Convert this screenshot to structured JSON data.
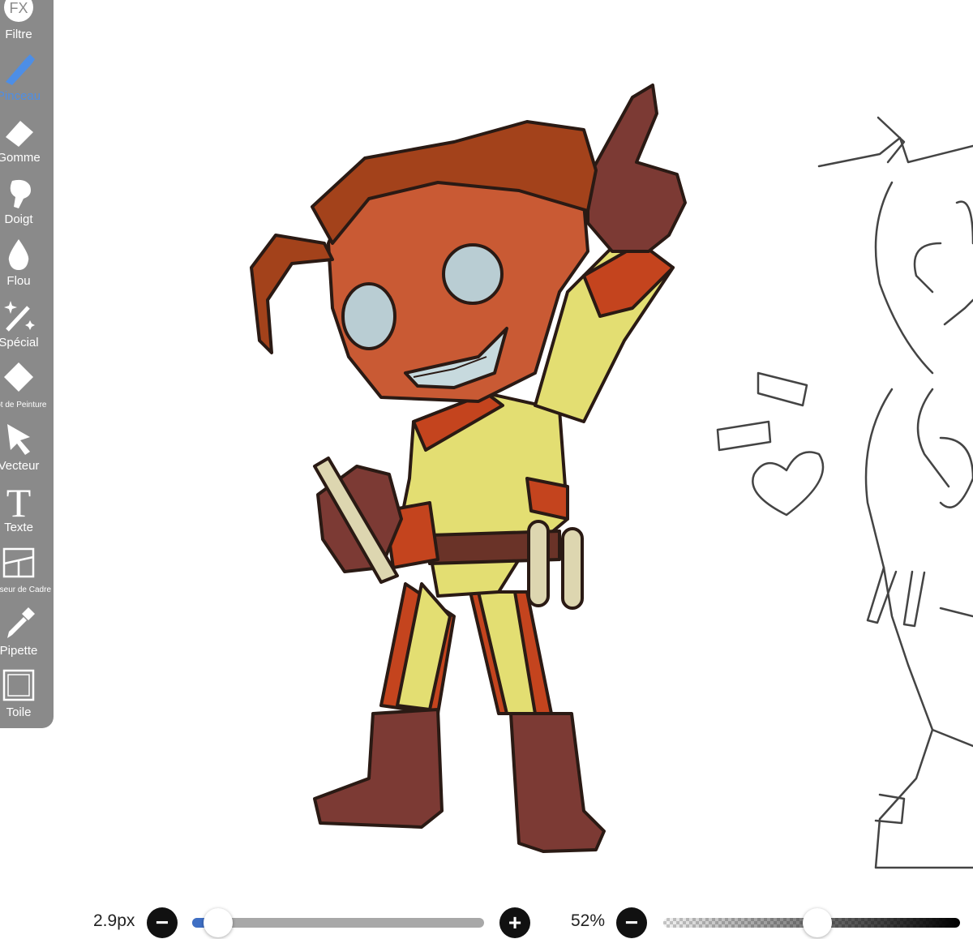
{
  "toolbar": {
    "tools": [
      {
        "name": "tool-filtre",
        "icon": "fx-icon",
        "label": "Filtre"
      },
      {
        "name": "tool-pinceau",
        "icon": "brush-icon",
        "label": "Pinceau",
        "active": true
      },
      {
        "name": "tool-gomme",
        "icon": "eraser-icon",
        "label": "Gomme"
      },
      {
        "name": "tool-doigt",
        "icon": "smudge-icon",
        "label": "Doigt"
      },
      {
        "name": "tool-flou",
        "icon": "blur-drop-icon",
        "label": "Flou"
      },
      {
        "name": "tool-special",
        "icon": "sparkle-wand-icon",
        "label": "Spécial"
      },
      {
        "name": "tool-pot-de-peinture",
        "icon": "paint-bucket-icon",
        "label": "Pot de Peinture"
      },
      {
        "name": "tool-vecteur",
        "icon": "arrow-pointer-icon",
        "label": "Vecteur"
      },
      {
        "name": "tool-texte",
        "icon": "text-t-icon",
        "label": "Texte"
      },
      {
        "name": "tool-diviseur-de-cadre",
        "icon": "frame-divider-icon",
        "label": "Diviseur de Cadre"
      },
      {
        "name": "tool-pipette",
        "icon": "eyedropper-icon",
        "label": "Pipette"
      },
      {
        "name": "tool-toile",
        "icon": "canvas-square-icon",
        "label": "Toile"
      }
    ]
  },
  "bottom_bar": {
    "brush_size": {
      "value_text": "2.9px",
      "slider_fraction": 0.09
    },
    "brush_opacity": {
      "value_text": "52%",
      "slider_fraction": 0.52
    }
  },
  "colors": {
    "toolbar_bg": "#8a8a8a",
    "active_tool": "#4d8ee6",
    "size_track_fill": "#3f6fc4",
    "button_bg": "#111111"
  }
}
